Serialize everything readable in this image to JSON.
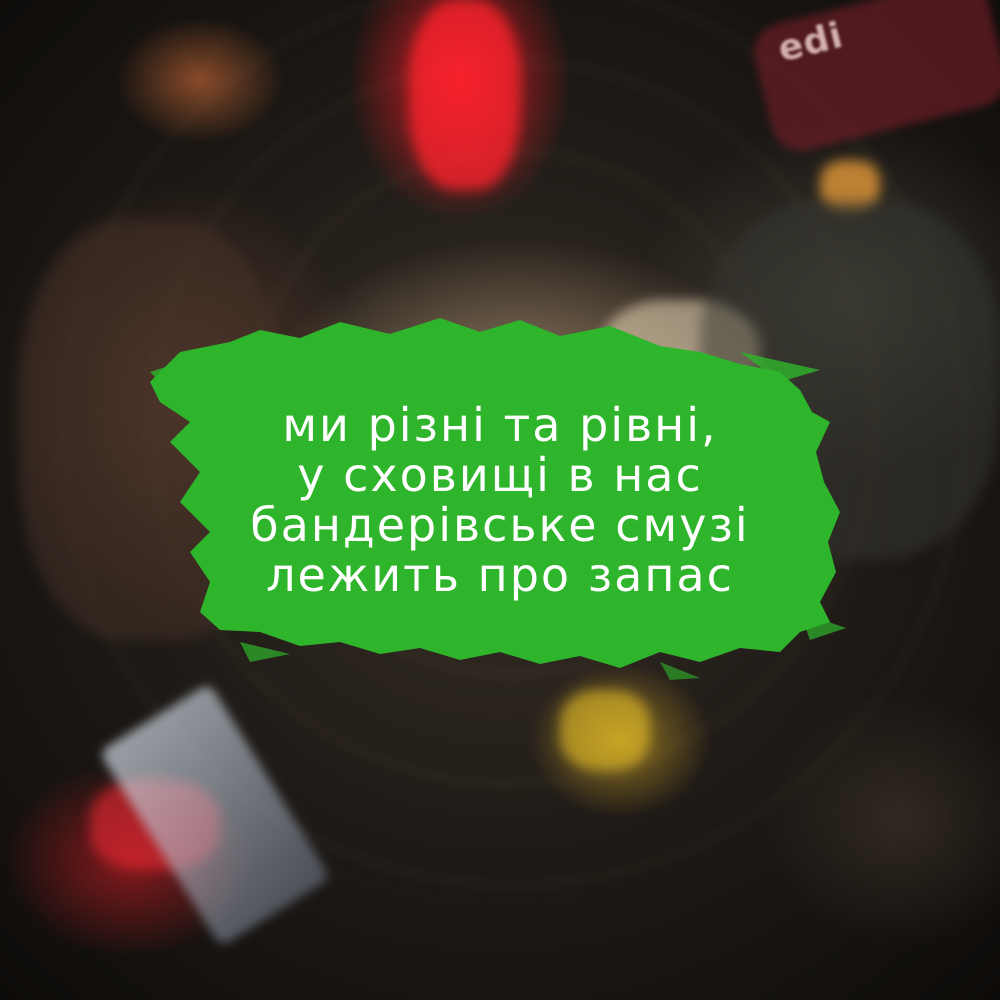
{
  "background": {
    "description_colors": {
      "red_light": "#ff1e28",
      "warm_light": "#ffdcaa",
      "dark": "#141210"
    },
    "sign_text": "edi"
  },
  "overlay": {
    "brush_color": "#2fb52c",
    "text_color": "#ffffff",
    "lines": [
      "ми різні та рівні,",
      "у сховищі в нас",
      "бандерівське смузі",
      "лежить про запас"
    ]
  }
}
